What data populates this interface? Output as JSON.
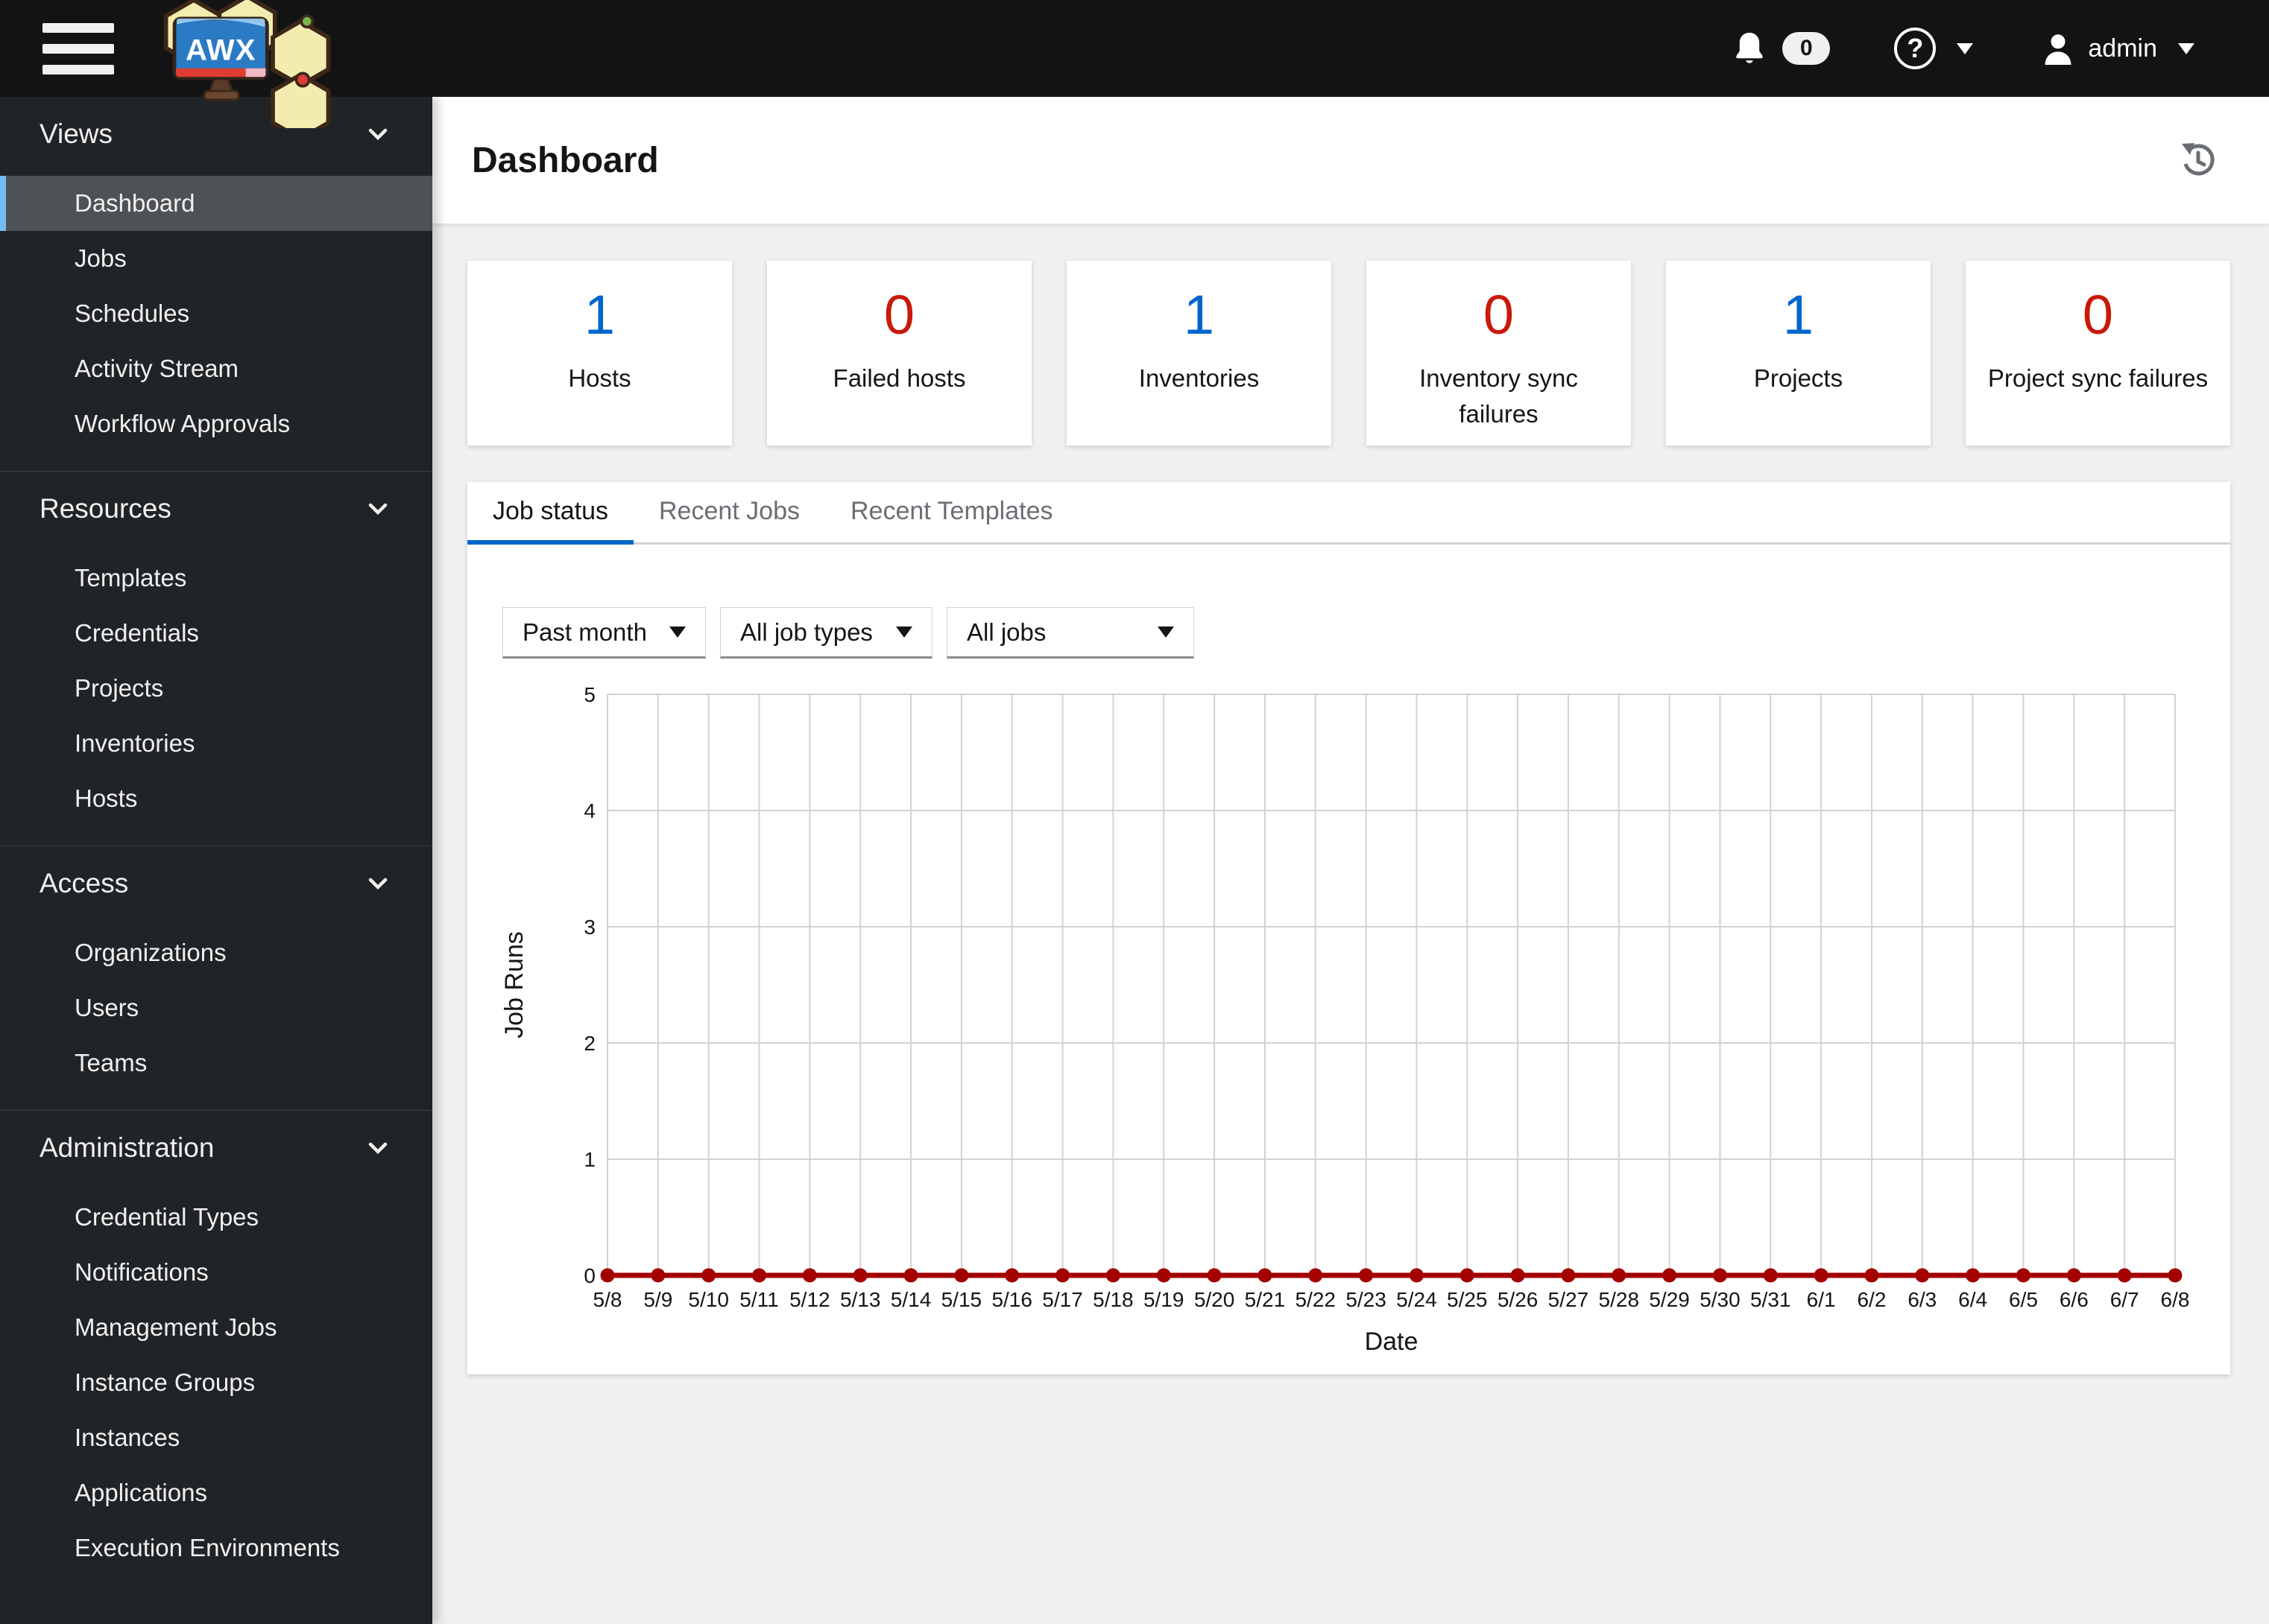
{
  "masthead": {
    "badge_count": "0",
    "username": "admin",
    "logo_text": "AWX"
  },
  "sidebar": {
    "sections": [
      {
        "label": "Views",
        "items": [
          {
            "label": "Dashboard",
            "active": true
          },
          {
            "label": "Jobs",
            "active": false
          },
          {
            "label": "Schedules",
            "active": false
          },
          {
            "label": "Activity Stream",
            "active": false
          },
          {
            "label": "Workflow Approvals",
            "active": false
          }
        ]
      },
      {
        "label": "Resources",
        "items": [
          {
            "label": "Templates",
            "active": false
          },
          {
            "label": "Credentials",
            "active": false
          },
          {
            "label": "Projects",
            "active": false
          },
          {
            "label": "Inventories",
            "active": false
          },
          {
            "label": "Hosts",
            "active": false
          }
        ]
      },
      {
        "label": "Access",
        "items": [
          {
            "label": "Organizations",
            "active": false
          },
          {
            "label": "Users",
            "active": false
          },
          {
            "label": "Teams",
            "active": false
          }
        ]
      },
      {
        "label": "Administration",
        "items": [
          {
            "label": "Credential Types",
            "active": false
          },
          {
            "label": "Notifications",
            "active": false
          },
          {
            "label": "Management Jobs",
            "active": false
          },
          {
            "label": "Instance Groups",
            "active": false
          },
          {
            "label": "Instances",
            "active": false
          },
          {
            "label": "Applications",
            "active": false
          },
          {
            "label": "Execution Environments",
            "active": false
          }
        ]
      }
    ]
  },
  "page": {
    "title": "Dashboard"
  },
  "stats": [
    {
      "value": "1",
      "label": "Hosts",
      "color": "#0066cc"
    },
    {
      "value": "0",
      "label": "Failed hosts",
      "color": "#c9190b"
    },
    {
      "value": "1",
      "label": "Inventories",
      "color": "#0066cc"
    },
    {
      "value": "0",
      "label": "Inventory sync failures",
      "color": "#c9190b"
    },
    {
      "value": "1",
      "label": "Projects",
      "color": "#0066cc"
    },
    {
      "value": "0",
      "label": "Project sync failures",
      "color": "#c9190b"
    }
  ],
  "tabs": [
    {
      "label": "Job status",
      "active": true
    },
    {
      "label": "Recent Jobs",
      "active": false
    },
    {
      "label": "Recent Templates",
      "active": false
    }
  ],
  "filters": [
    {
      "value": "Past month"
    },
    {
      "value": "All job types"
    },
    {
      "value": "All jobs"
    }
  ],
  "colors": {
    "accent": "#0066cc",
    "danger": "#c9190b",
    "chart_line": "#a30000",
    "active_indicator": "#73bcf7",
    "gridline": "#d2d2d2"
  },
  "chart_data": {
    "type": "line",
    "title": "",
    "xlabel": "Date",
    "ylabel": "Job Runs",
    "x": [
      "5/8",
      "5/9",
      "5/10",
      "5/11",
      "5/12",
      "5/13",
      "5/14",
      "5/15",
      "5/16",
      "5/17",
      "5/18",
      "5/19",
      "5/20",
      "5/21",
      "5/22",
      "5/23",
      "5/24",
      "5/25",
      "5/26",
      "5/27",
      "5/28",
      "5/29",
      "5/30",
      "5/31",
      "6/1",
      "6/2",
      "6/3",
      "6/4",
      "6/5",
      "6/6",
      "6/7",
      "6/8"
    ],
    "values": [
      0,
      0,
      0,
      0,
      0,
      0,
      0,
      0,
      0,
      0,
      0,
      0,
      0,
      0,
      0,
      0,
      0,
      0,
      0,
      0,
      0,
      0,
      0,
      0,
      0,
      0,
      0,
      0,
      0,
      0,
      0,
      0
    ],
    "ylim": [
      0,
      5
    ],
    "yticks": [
      0,
      1,
      2,
      3,
      4,
      5
    ],
    "grid": true,
    "legend": "none",
    "line_color": "#a30000"
  }
}
